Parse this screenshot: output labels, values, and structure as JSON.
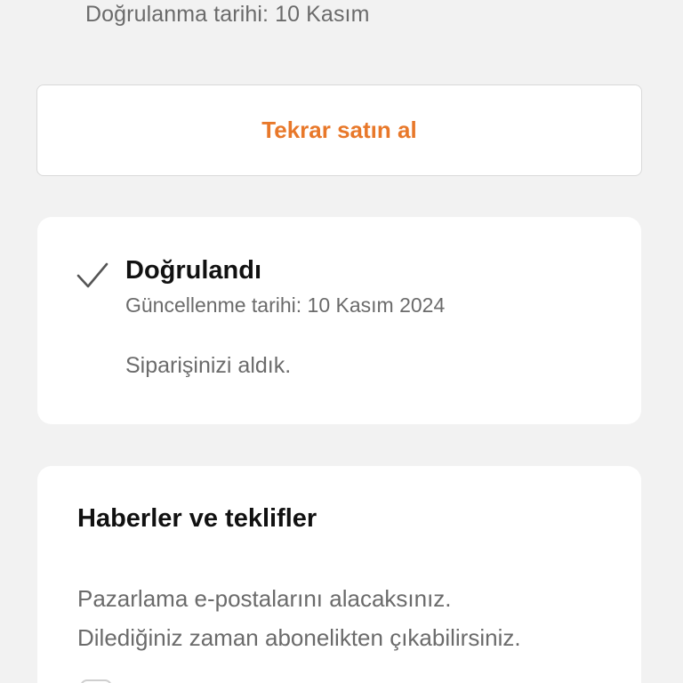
{
  "order": {
    "verified_date": "Doğrulanma tarihi: 10 Kasım"
  },
  "actions": {
    "buy_again_label": "Tekrar satın al"
  },
  "status": {
    "icon": "checkmark-icon",
    "title": "Doğrulandı",
    "updated": "Güncellenme tarihi: 10 Kasım 2024",
    "message": "Siparişinizi aldık."
  },
  "news": {
    "title": "Haberler ve teklifler",
    "description_line1": "Pazarlama e-postalarını alacaksınız.",
    "description_line2": "Dilediğiniz zaman abonelikten çıkabilirsiniz.",
    "checkbox_checked": false
  },
  "colors": {
    "accent": "#e8782a",
    "background": "#f2f2f2",
    "card": "#ffffff",
    "text_primary": "#111111",
    "text_secondary": "#6b6b6b"
  }
}
